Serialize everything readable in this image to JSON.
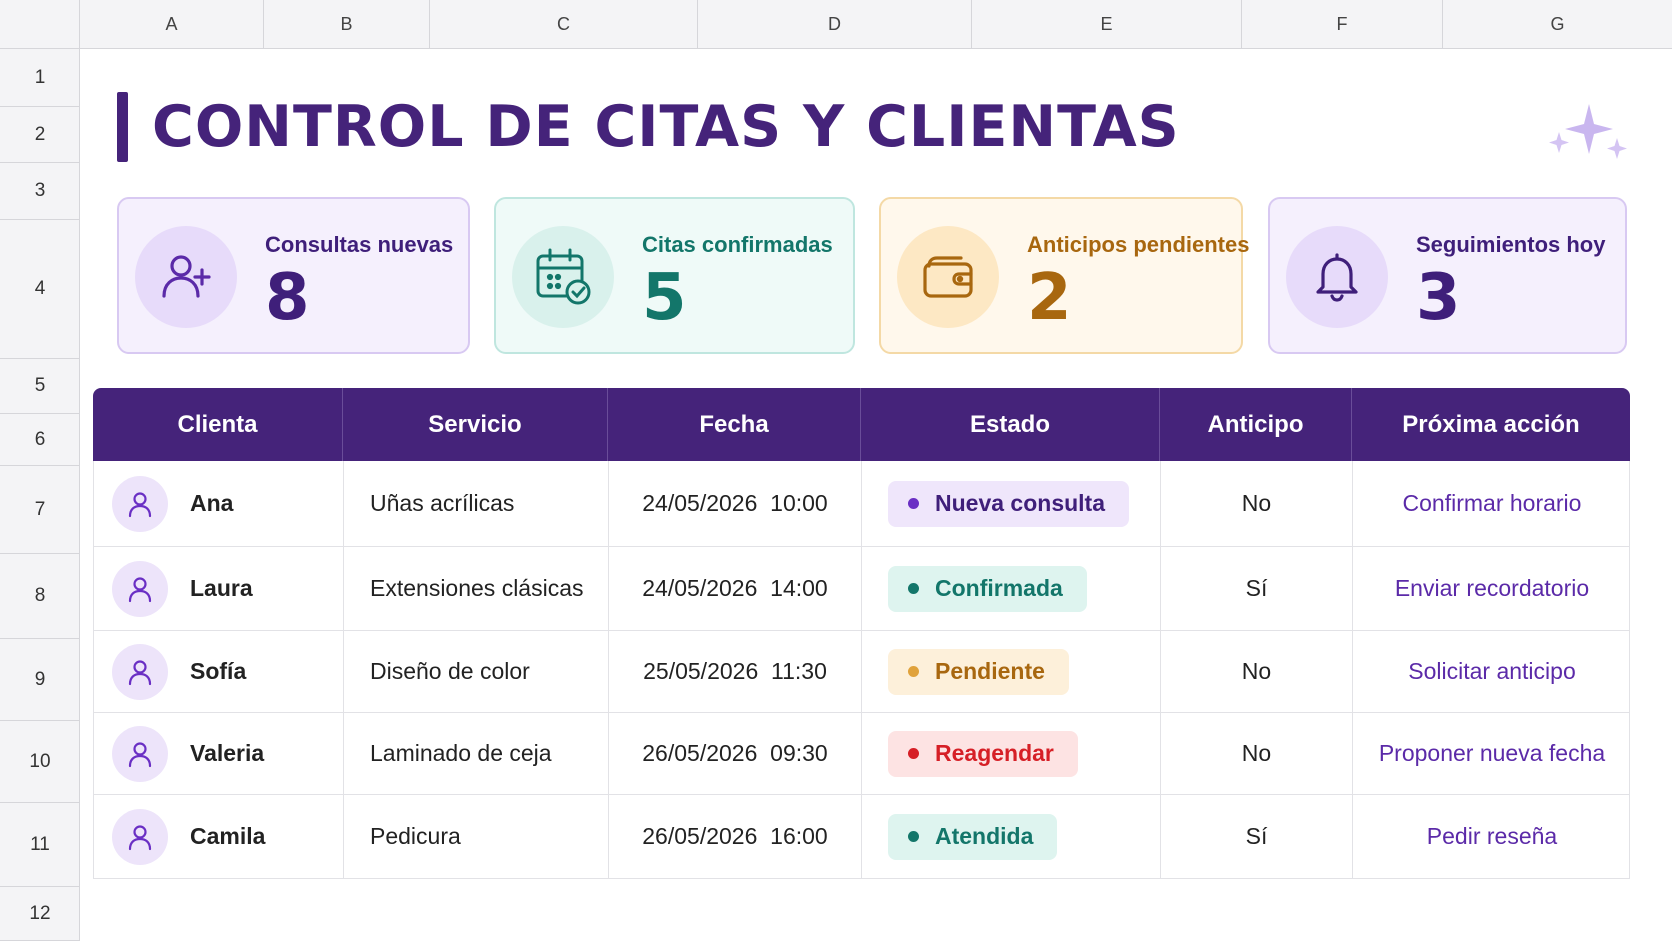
{
  "sheet": {
    "columns": [
      "A",
      "B",
      "C",
      "D",
      "E",
      "F",
      "G"
    ],
    "rows": [
      "1",
      "2",
      "3",
      "4",
      "5",
      "6",
      "7",
      "8",
      "9",
      "10",
      "11",
      "12"
    ]
  },
  "title": "CONTROL DE CITAS Y CLIENTAS",
  "colors": {
    "brand": "#45237a",
    "accent_purple": "#6a2fc4",
    "teal": "#13766a",
    "amber": "#a8670f",
    "red": "#d61f26"
  },
  "kpis": [
    {
      "label": "Consultas nuevas",
      "value": "8",
      "icon": "user-plus-icon"
    },
    {
      "label": "Citas confirmadas",
      "value": "5",
      "icon": "calendar-check-icon"
    },
    {
      "label": "Anticipos pendientes",
      "value": "2",
      "icon": "wallet-icon"
    },
    {
      "label": "Seguimientos hoy",
      "value": "3",
      "icon": "bell-icon"
    }
  ],
  "table": {
    "headers": [
      "Clienta",
      "Servicio",
      "Fecha",
      "Estado",
      "Anticipo",
      "Próxima acción"
    ],
    "rows": [
      {
        "client": "Ana",
        "service": "Uñas acrílicas",
        "date": "24/05/2026  10:00",
        "status": "Nueva consulta",
        "deposit": "No",
        "action": "Confirmar horario"
      },
      {
        "client": "Laura",
        "service": "Extensiones clásicas",
        "date": "24/05/2026  14:00",
        "status": "Confirmada",
        "deposit": "Sí",
        "action": "Enviar recordatorio"
      },
      {
        "client": "Sofía",
        "service": "Diseño de color",
        "date": "25/05/2026  11:30",
        "status": "Pendiente",
        "deposit": "No",
        "action": "Solicitar anticipo"
      },
      {
        "client": "Valeria",
        "service": "Laminado de ceja",
        "date": "26/05/2026  09:30",
        "status": "Reagendar",
        "deposit": "No",
        "action": "Proponer nueva fecha"
      },
      {
        "client": "Camila",
        "service": "Pedicura",
        "date": "26/05/2026  16:00",
        "status": "Atendida",
        "deposit": "Sí",
        "action": "Pedir reseña"
      }
    ]
  }
}
